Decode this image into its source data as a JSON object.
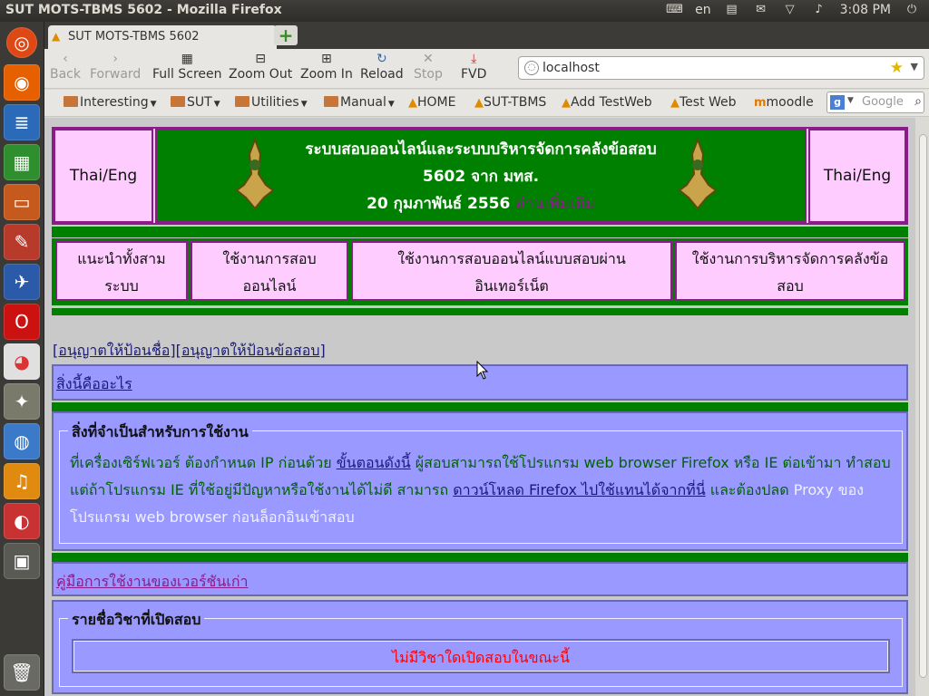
{
  "panel": {
    "window_title": "SUT MOTS-TBMS 5602 - Mozilla Firefox",
    "keyboard_layout": "en",
    "clock": "3:08 PM"
  },
  "launcher": {
    "items": [
      "ubuntu-logo-icon",
      "firefox-icon",
      "writer-icon",
      "calc-icon",
      "impress-icon",
      "settings-icon",
      "thunderbird-icon",
      "opera-icon",
      "chrome-icon",
      "gimp-icon",
      "internet-icon",
      "audio-icon",
      "game-icon",
      "workspace-icon",
      "trash-icon"
    ]
  },
  "browser": {
    "tab_title": "SUT MOTS-TBMS 5602",
    "nav": {
      "back": "Back",
      "forward": "Forward",
      "fullscreen": "Full Screen",
      "zoom_out": "Zoom Out",
      "zoom_in": "Zoom In",
      "reload": "Reload",
      "stop": "Stop",
      "fvd": "FVD"
    },
    "url": "localhost",
    "bookmarks": [
      {
        "label": "Interesting",
        "type": "folder"
      },
      {
        "label": "SUT",
        "type": "folder"
      },
      {
        "label": "Utilities",
        "type": "folder"
      },
      {
        "label": "Manual",
        "type": "folder"
      },
      {
        "label": "HOME",
        "type": "link"
      },
      {
        "label": "SUT-TBMS",
        "type": "link"
      },
      {
        "label": "Add TestWeb",
        "type": "link"
      },
      {
        "label": "Test Web",
        "type": "link"
      },
      {
        "label": "moodle",
        "type": "link"
      }
    ],
    "search_placeholder": "Google"
  },
  "page": {
    "lang_left": "Thai/Eng",
    "lang_right": "Thai/Eng",
    "banner": {
      "line1": "ระบบสอบออนไลน์และระบบบริหารจัดการคลังข้อสอบ",
      "line2": "5602 จาก มทส.",
      "date": "20 กุมภาพันธ์ 2556",
      "more_link": "อ่านเพิ่มเติม"
    },
    "menu": [
      {
        "line1": "แนะนำทั้งสาม",
        "line2": "ระบบ"
      },
      {
        "line1": "ใช้งานการสอบ",
        "line2": "ออนไลน์"
      },
      {
        "line1": "ใช้งานการสอบออนไลน์แบบสอบผ่าน",
        "line2": "อินเทอร์เน็ต"
      },
      {
        "line1": "ใช้งานการบริหารจัดการคลังข้อ",
        "line2": "สอบ"
      }
    ],
    "permissions_link": "[อนุญาตให้ป้อนชื่อ][อนุญาตให้ป้อนข้อสอบ]",
    "what_is_this": "สิ่งนี้คืออะไร",
    "requirements": {
      "legend": "สิ่งที่จำเป็นสำหรับการใช้งาน",
      "t1": "ที่เครื่องเซิร์ฟเวอร์ ต้องกำหนด IP ก่อนด้วย",
      "link1": "ขั้นตอนดังนี้",
      "t2": "ผู้สอบสามารถใช้โปรแกรม web browser Firefox หรือ IE ต่อเข้ามา",
      "t3": "ทำสอบ แต่ถ้าโปรแกรม IE ที่ใช้อยู่มีปัญหาหรือใช้งานได้ไม่ดี สามารถ",
      "link2": "ดาวน์โหลด Firefox ไปใช้แทนได้จากที่นี่",
      "t4": "และต้องปลด",
      "t5": "Proxy ของโปรแกรม web browser ก่อนล็อกอินเข้าสอบ"
    },
    "old_manual": "คู่มือการใช้งานของเวอร์ชันเก่า",
    "courses": {
      "legend": "รายชื่อวิชาที่เปิดสอบ",
      "empty_msg": "ไม่มีวิชาใดเปิดสอบในขณะนี้"
    }
  },
  "colors": {
    "green": "#008000",
    "pink": "#ffccff",
    "lavender": "#9999ff",
    "red_msg": "#ff0000"
  }
}
